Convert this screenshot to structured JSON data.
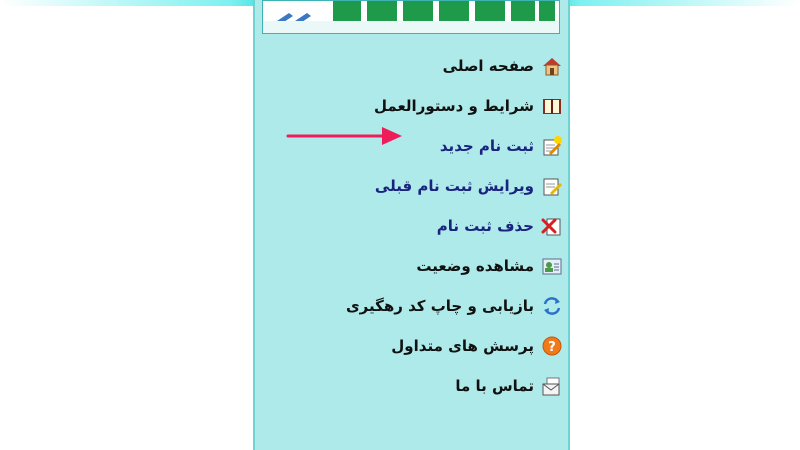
{
  "colors": {
    "panel_bg": "#aeeaea",
    "panel_border": "#6fd3d3",
    "link_text": "#1a237e",
    "default_text": "#111111",
    "arrow": "#ee1d5a"
  },
  "menu": {
    "items": [
      {
        "label": "صفحه اصلی",
        "icon": "home-icon"
      },
      {
        "label": "شرایط و دستورالعمل",
        "icon": "book-icon"
      },
      {
        "label": "ثبت نام جدید",
        "icon": "new-registration-icon"
      },
      {
        "label": "ویرایش ثبت نام قبلی",
        "icon": "edit-icon"
      },
      {
        "label": "حذف ثبت نام",
        "icon": "delete-icon"
      },
      {
        "label": "مشاهده وضعیت",
        "icon": "status-card-icon"
      },
      {
        "label": "بازیابی و چاپ کد رهگیری",
        "icon": "refresh-icon"
      },
      {
        "label": "پرسش های متداول",
        "icon": "question-icon"
      },
      {
        "label": "تماس با ما",
        "icon": "envelope-icon"
      }
    ]
  }
}
